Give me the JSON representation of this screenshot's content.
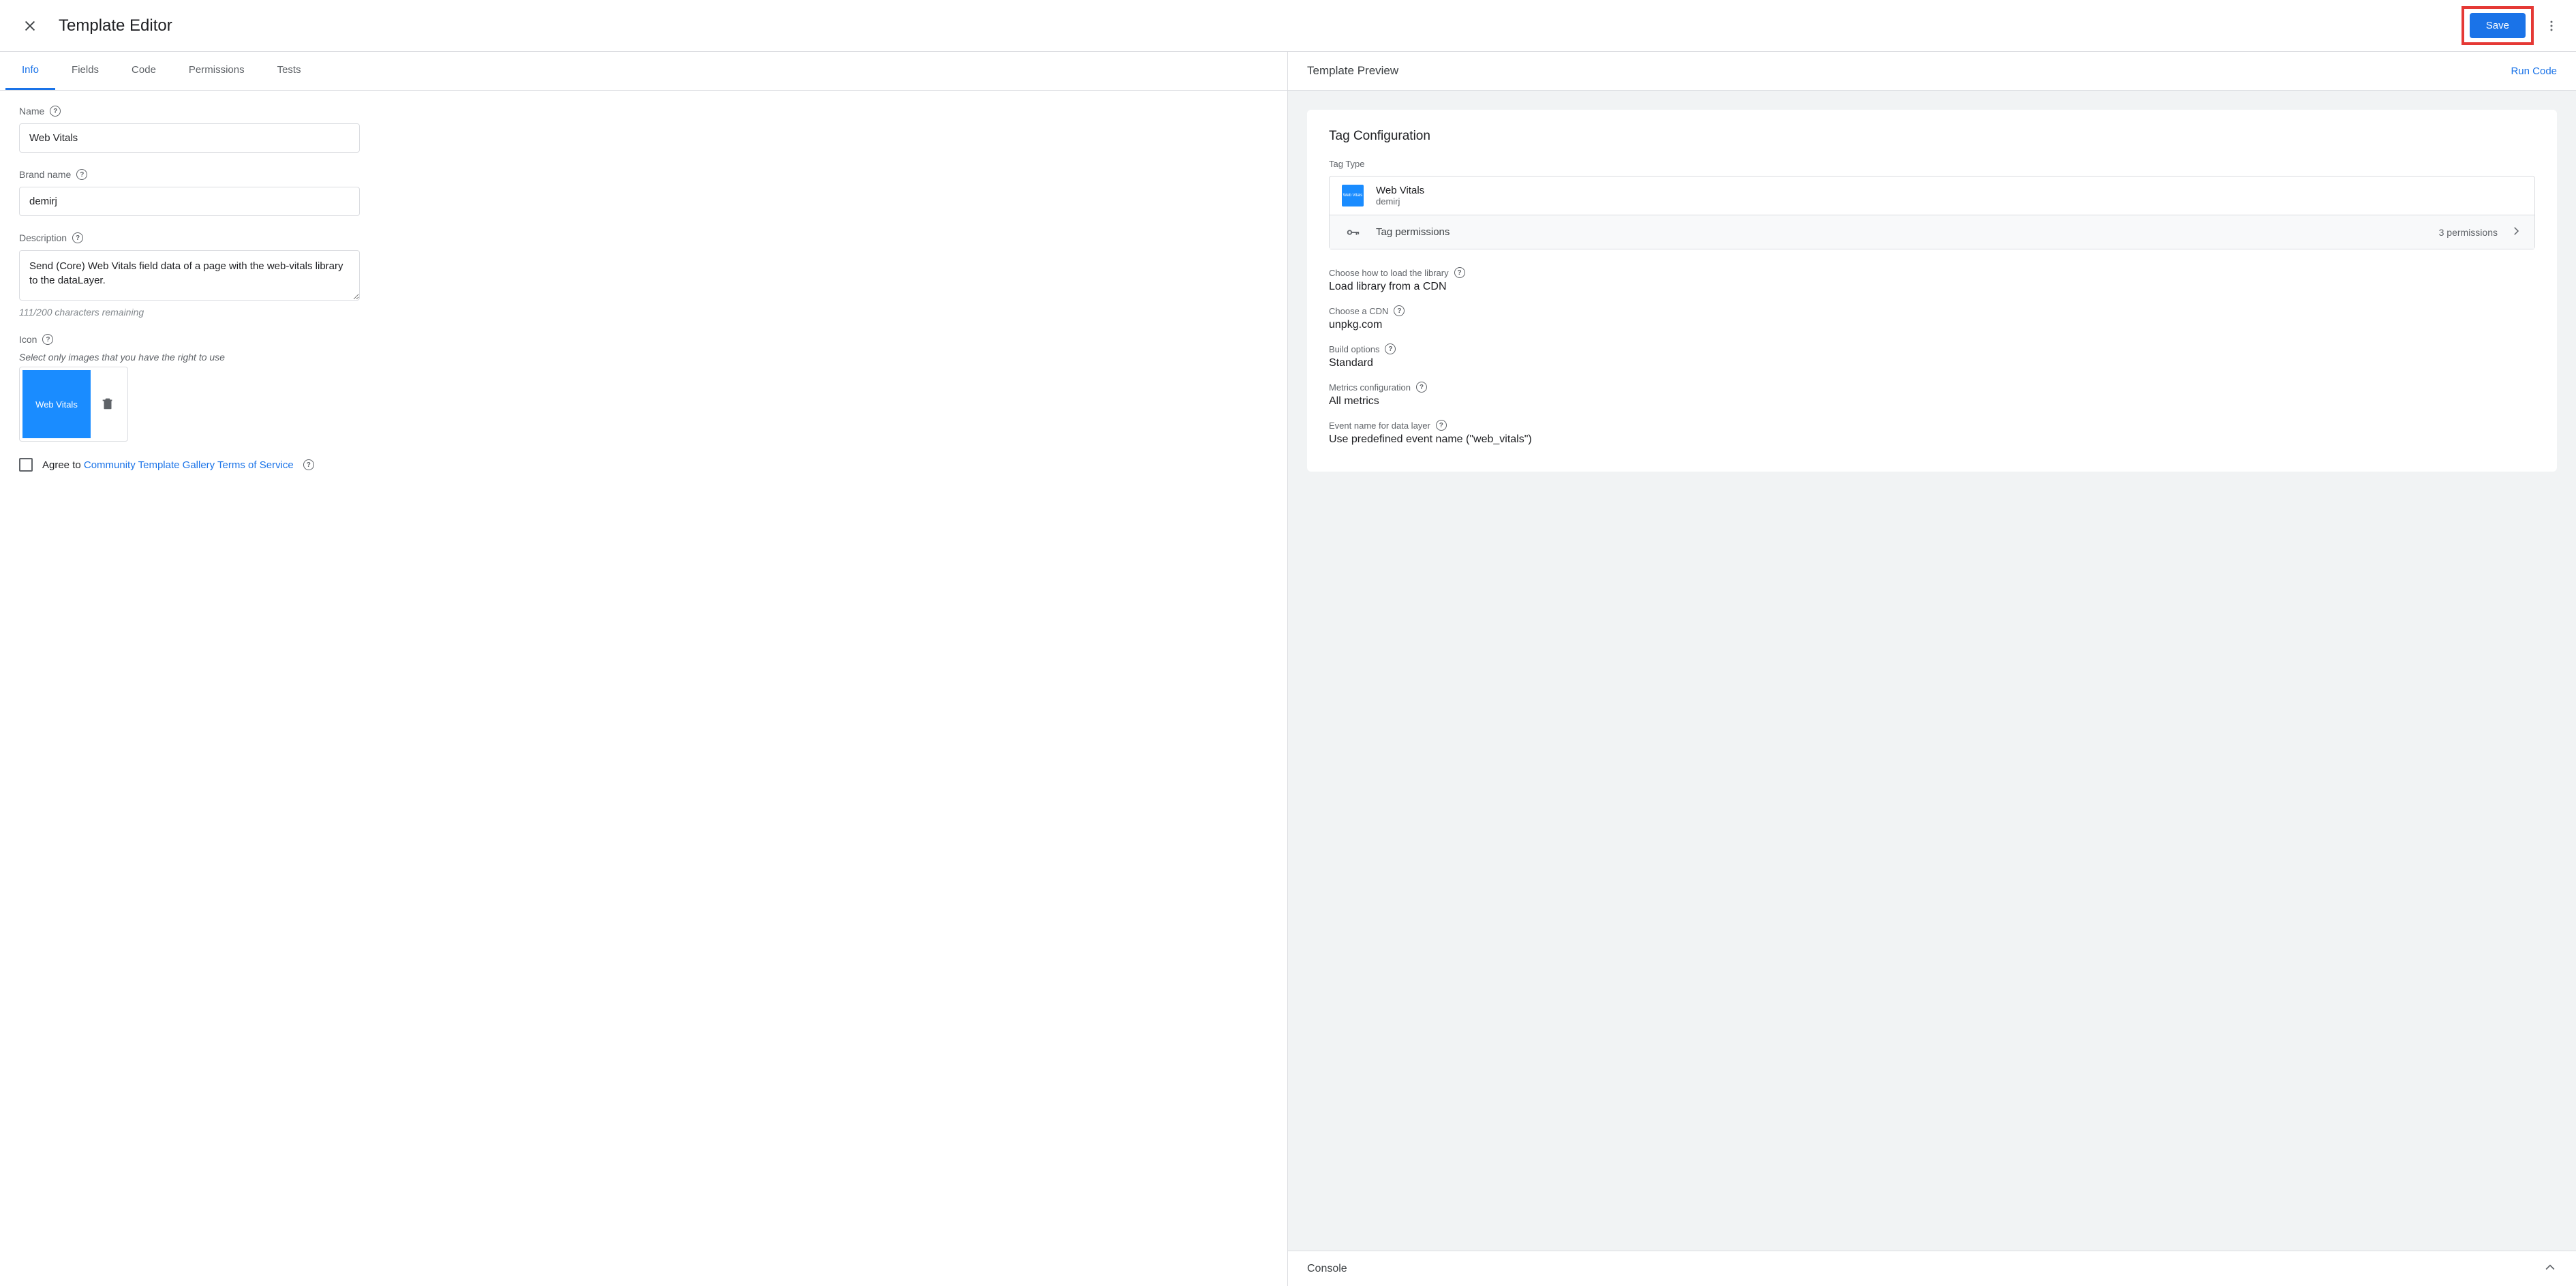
{
  "header": {
    "title": "Template Editor",
    "save_label": "Save"
  },
  "tabs": [
    {
      "label": "Info",
      "active": true
    },
    {
      "label": "Fields",
      "active": false
    },
    {
      "label": "Code",
      "active": false
    },
    {
      "label": "Permissions",
      "active": false
    },
    {
      "label": "Tests",
      "active": false
    }
  ],
  "form": {
    "name_label": "Name",
    "name_value": "Web Vitals",
    "brand_label": "Brand name",
    "brand_value": "demirj",
    "description_label": "Description",
    "description_value": "Send (Core) Web Vitals field data of a page with the web-vitals library to the dataLayer.",
    "description_remaining": "111/200 characters remaining",
    "icon_label": "Icon",
    "icon_hint": "Select only images that you have the right to use",
    "icon_thumb_text": "Web Vitals",
    "agree_prefix": "Agree to ",
    "agree_link": "Community Template Gallery Terms of Service"
  },
  "preview": {
    "title": "Template Preview",
    "run_code": "Run Code",
    "card_heading": "Tag Configuration",
    "tag_type_label": "Tag Type",
    "tag_name": "Web Vitals",
    "tag_brand": "demirj",
    "tag_permissions_label": "Tag permissions",
    "tag_permissions_count": "3 permissions",
    "settings": [
      {
        "label": "Choose how to load the library",
        "value": "Load library from a CDN"
      },
      {
        "label": "Choose a CDN",
        "value": "unpkg.com"
      },
      {
        "label": "Build options",
        "value": "Standard"
      },
      {
        "label": "Metrics configuration",
        "value": "All metrics"
      },
      {
        "label": "Event name for data layer",
        "value": "Use predefined event name (\"web_vitals\")"
      }
    ]
  },
  "console": {
    "title": "Console"
  }
}
